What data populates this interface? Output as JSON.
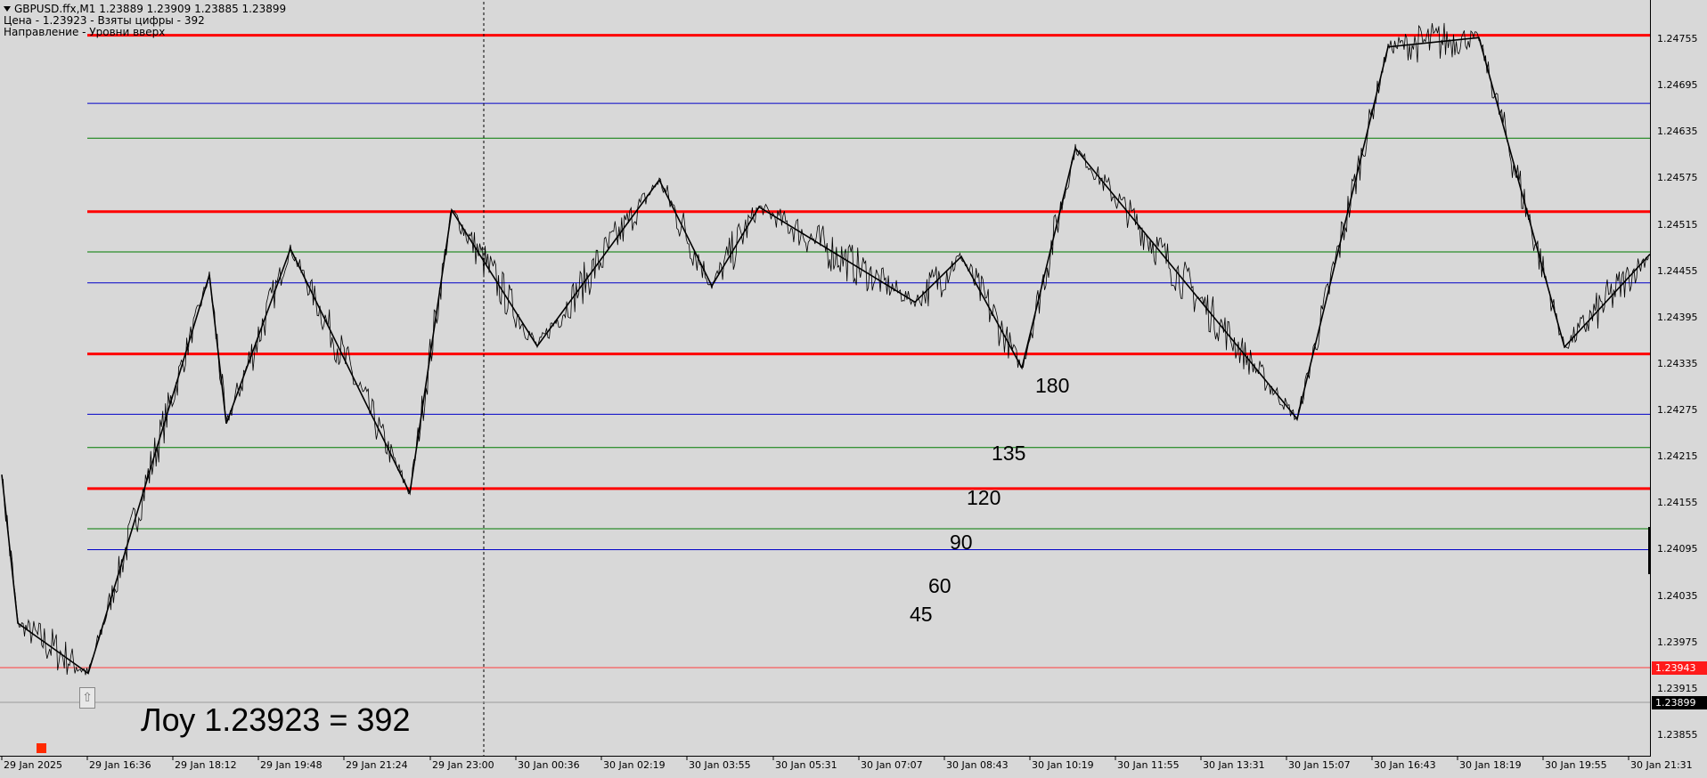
{
  "window": {
    "symbol_line": "GBPUSD.ffx,M1  1.23889 1.23909 1.23885 1.23899",
    "info_line_1": "Цена - 1.23923 - Взяты цифры - 392",
    "info_line_2": "Направление - Уровни вверх"
  },
  "price_axis": {
    "ticks": [
      "1.24755",
      "1.24695",
      "1.24635",
      "1.24575",
      "1.24515",
      "1.24455",
      "1.24395",
      "1.24335",
      "1.24275",
      "1.24215",
      "1.24155",
      "1.24095",
      "1.24035",
      "1.23975",
      "1.23915",
      "1.23855"
    ],
    "bid_tag": "1.23899",
    "ask_tag": "1.23943",
    "ask_color": "#ff1a1a"
  },
  "time_axis": {
    "ticks": [
      "29 Jan 2025",
      "29 Jan 16:36",
      "29 Jan 18:12",
      "29 Jan 19:48",
      "29 Jan 21:24",
      "29 Jan 23:00",
      "30 Jan 00:36",
      "30 Jan 02:19",
      "30 Jan 03:55",
      "30 Jan 05:31",
      "30 Jan 07:07",
      "30 Jan 08:43",
      "30 Jan 10:19",
      "30 Jan 11:55",
      "30 Jan 13:31",
      "30 Jan 15:07",
      "30 Jan 16:43",
      "30 Jan 18:19",
      "30 Jan 19:55",
      "30 Jan 21:31"
    ]
  },
  "levels": {
    "labels": [
      "180",
      "135",
      "120",
      "90",
      "60",
      "45"
    ],
    "low_label": "Лоу 1.23923 = 392",
    "colors": {
      "red": "#ff0000",
      "green": "#007a00",
      "blue": "#0000c8"
    }
  },
  "chart_data": {
    "type": "line",
    "symbol": "GBPUSD.ffx",
    "timeframe": "M1",
    "ylim": [
      1.2383,
      1.2478
    ],
    "level_lines": [
      {
        "price": 1.2476,
        "color": "red"
      },
      {
        "price": 1.24672,
        "color": "blue"
      },
      {
        "price": 1.24627,
        "color": "green"
      },
      {
        "price": 1.24532,
        "color": "red"
      },
      {
        "price": 1.2448,
        "color": "green"
      },
      {
        "price": 1.2444,
        "color": "blue"
      },
      {
        "price": 1.24348,
        "color": "red"
      },
      {
        "price": 1.2427,
        "color": "blue"
      },
      {
        "price": 1.24227,
        "color": "green"
      },
      {
        "price": 1.24174,
        "color": "red"
      },
      {
        "price": 1.24122,
        "color": "green"
      },
      {
        "price": 1.24095,
        "color": "blue"
      }
    ],
    "zigzag": [
      [
        0,
        1.24192
      ],
      [
        1,
        1.23955
      ],
      [
        2,
        1.2445
      ],
      [
        3,
        1.24259
      ],
      [
        4,
        1.24484
      ],
      [
        5,
        1.24168
      ],
      [
        6,
        1.24534
      ],
      [
        7,
        1.24358
      ],
      [
        8,
        1.2457
      ],
      [
        9,
        1.24436
      ],
      [
        10,
        1.24541
      ],
      [
        11,
        1.24415
      ],
      [
        12,
        1.24474
      ],
      [
        13,
        1.24328
      ],
      [
        14,
        1.24614
      ],
      [
        15,
        1.24264
      ],
      [
        16,
        1.24755
      ],
      [
        17,
        1.24357
      ],
      [
        18,
        1.24477
      ]
    ]
  }
}
